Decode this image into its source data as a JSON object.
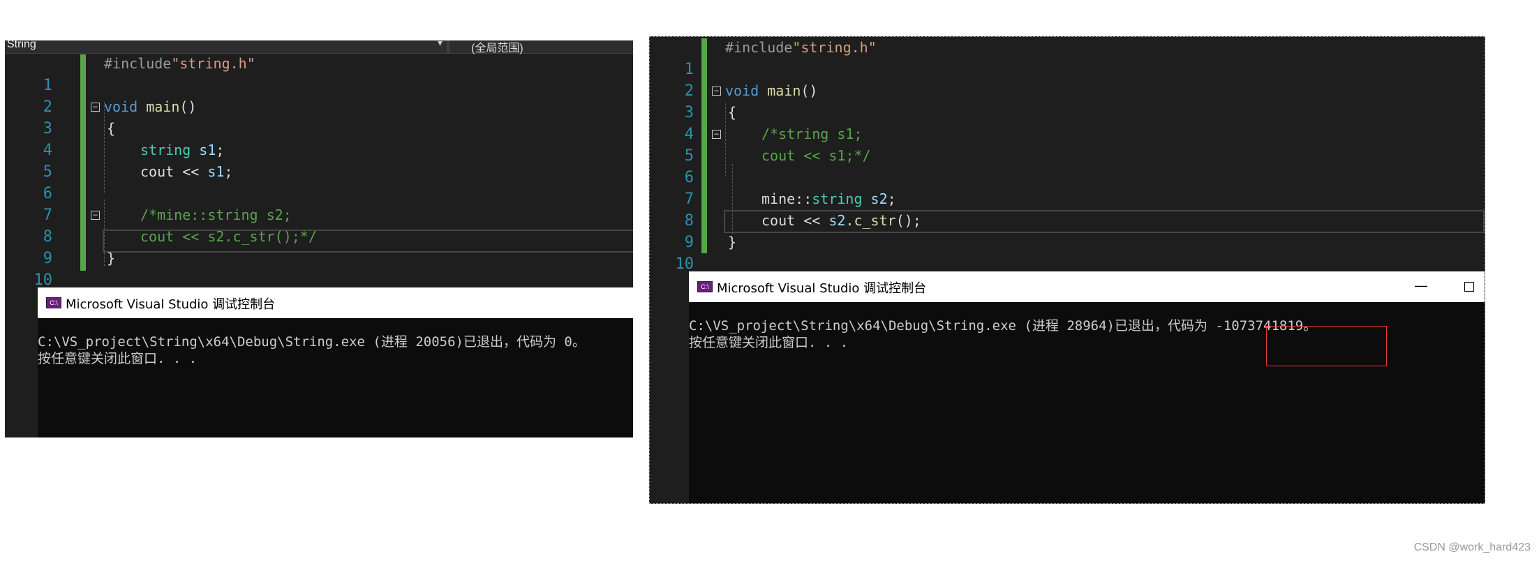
{
  "left": {
    "navbar": {
      "scope_left": "String",
      "scope_right": "(全局范围)"
    },
    "code_lines": [
      "1",
      "2",
      "3",
      "4",
      "5",
      "6",
      "7",
      "8",
      "9",
      "10"
    ],
    "code": {
      "l1_pp": "#include",
      "l1_str": "\"string.h\"",
      "l3_kw": "void",
      "l3_fn": "main",
      "l3_pl": "()",
      "l4": "{",
      "l5_ty": "string",
      "l5_var": "s1",
      "l5_pl": ";",
      "l6_pl1": "cout << ",
      "l6_var": "s1",
      "l6_pl2": ";",
      "l8_cm": "/*mine::string s2;",
      "l9_cm": "cout << s2.c_str();*/",
      "l10": "}"
    },
    "console": {
      "title": "Microsoft Visual Studio 调试控制台",
      "line1": "C:\\VS_project\\String\\x64\\Debug\\String.exe (进程 20056)已退出，代码为 0。",
      "line2": "按任意键关闭此窗口. . ."
    }
  },
  "right": {
    "code_lines": [
      "1",
      "2",
      "3",
      "4",
      "5",
      "6",
      "7",
      "8",
      "9",
      "10"
    ],
    "code": {
      "l1_pp": "#include",
      "l1_str": "\"string.h\"",
      "l3_kw": "void",
      "l3_fn": "main",
      "l3_pl": "()",
      "l4": "{",
      "l5_cm": "/*string s1;",
      "l6_cm": "cout << s1;*/",
      "l8_pl": "mine::",
      "l8_ty": "string",
      "l8_var": "s2",
      "l8_pl2": ";",
      "l9_pl1": "cout << ",
      "l9_var": "s2",
      "l9_pl2": ".",
      "l9_fn": "c_str",
      "l9_pl3": "();",
      "l10": "}"
    },
    "console": {
      "title": "Microsoft Visual Studio 调试控制台",
      "line1_prefix": "C:\\VS_project\\String\\x64\\Debug\\String.exe (进程 28964)已退出，代码为 ",
      "exit_code": "-1073741819。",
      "line2": "按任意键关闭此窗口. . .",
      "minimize": "—",
      "icon_label": "C:\\"
    }
  },
  "watermark": "CSDN @work_hard423",
  "colors": {
    "editor_bg": "#1e1e1e",
    "keyword": "#569cd6",
    "type": "#4ec9b0",
    "function": "#dcdcaa",
    "comment": "#57a64a",
    "string": "#d69d85",
    "highlight_box": "#e53935"
  }
}
